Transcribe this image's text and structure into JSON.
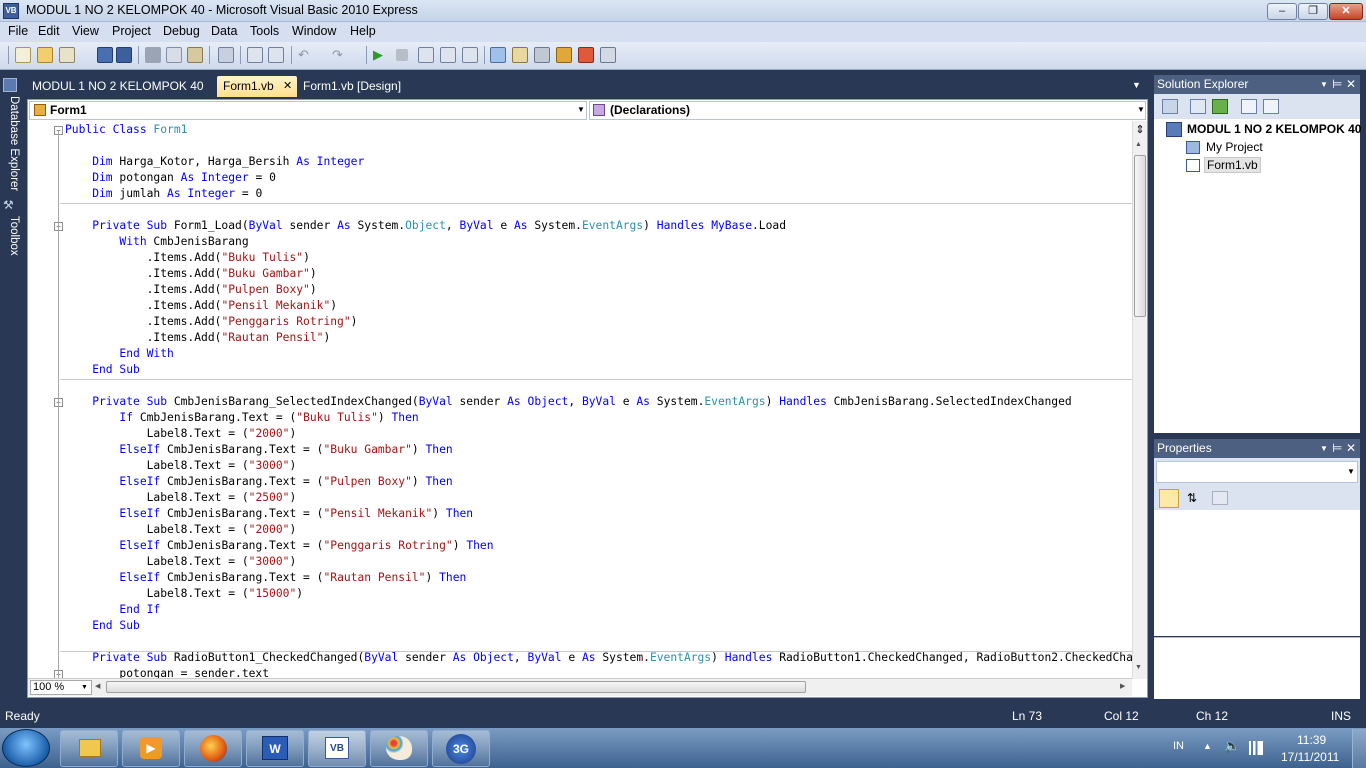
{
  "window": {
    "title": "MODUL 1 NO 2 KELOMPOK 40 - Microsoft Visual Basic 2010 Express",
    "app_icon": "VB"
  },
  "menu": [
    "File",
    "Edit",
    "View",
    "Project",
    "Debug",
    "Data",
    "Tools",
    "Window",
    "Help"
  ],
  "side_tabs": {
    "database_explorer": "Database Explorer",
    "toolbox": "Toolbox"
  },
  "doc_tabs": [
    "MODUL 1 NO 2 KELOMPOK 40",
    "Form1.vb",
    "Form1.vb [Design]"
  ],
  "editor": {
    "class_dropdown": "Form1",
    "method_dropdown": "(Declarations)",
    "zoom": "100 %"
  },
  "code": [
    [
      [
        "kw",
        "Public Class "
      ],
      [
        "ty",
        "Form1"
      ]
    ],
    [],
    [
      [
        "kw",
        "    Dim "
      ],
      [
        "n",
        "Harga_Kotor, Harga_Bersih "
      ],
      [
        "kw",
        "As Integer"
      ]
    ],
    [
      [
        "kw",
        "    Dim "
      ],
      [
        "n",
        "potongan "
      ],
      [
        "kw",
        "As Integer "
      ],
      [
        "n",
        "= 0"
      ]
    ],
    [
      [
        "kw",
        "    Dim "
      ],
      [
        "n",
        "jumlah "
      ],
      [
        "kw",
        "As Integer "
      ],
      [
        "n",
        "= 0"
      ]
    ],
    [],
    [
      [
        "kw",
        "    Private Sub "
      ],
      [
        "n",
        "Form1_Load("
      ],
      [
        "kw",
        "ByVal "
      ],
      [
        "n",
        "sender "
      ],
      [
        "kw",
        "As "
      ],
      [
        "n",
        "System."
      ],
      [
        "ty",
        "Object"
      ],
      [
        "n",
        ", "
      ],
      [
        "kw",
        "ByVal "
      ],
      [
        "n",
        "e "
      ],
      [
        "kw",
        "As "
      ],
      [
        "n",
        "System."
      ],
      [
        "ty",
        "EventArgs"
      ],
      [
        "n",
        ") "
      ],
      [
        "kw",
        "Handles MyBase"
      ],
      [
        "n",
        ".Load"
      ]
    ],
    [
      [
        "kw",
        "        With "
      ],
      [
        "n",
        "CmbJenisBarang"
      ]
    ],
    [
      [
        "n",
        "            .Items.Add("
      ],
      [
        "st",
        "\"Buku Tulis\""
      ],
      [
        "n",
        ")"
      ]
    ],
    [
      [
        "n",
        "            .Items.Add("
      ],
      [
        "st",
        "\"Buku Gambar\""
      ],
      [
        "n",
        ")"
      ]
    ],
    [
      [
        "n",
        "            .Items.Add("
      ],
      [
        "st",
        "\"Pulpen Boxy\""
      ],
      [
        "n",
        ")"
      ]
    ],
    [
      [
        "n",
        "            .Items.Add("
      ],
      [
        "st",
        "\"Pensil Mekanik\""
      ],
      [
        "n",
        ")"
      ]
    ],
    [
      [
        "n",
        "            .Items.Add("
      ],
      [
        "st",
        "\"Penggaris Rotring\""
      ],
      [
        "n",
        ")"
      ]
    ],
    [
      [
        "n",
        "            .Items.Add("
      ],
      [
        "st",
        "\"Rautan Pensil\""
      ],
      [
        "n",
        ")"
      ]
    ],
    [
      [
        "kw",
        "        End With"
      ]
    ],
    [
      [
        "kw",
        "    End Sub"
      ]
    ],
    [],
    [
      [
        "kw",
        "    Private Sub "
      ],
      [
        "n",
        "CmbJenisBarang_SelectedIndexChanged("
      ],
      [
        "kw",
        "ByVal "
      ],
      [
        "n",
        "sender "
      ],
      [
        "kw",
        "As Object"
      ],
      [
        "n",
        ", "
      ],
      [
        "kw",
        "ByVal "
      ],
      [
        "n",
        "e "
      ],
      [
        "kw",
        "As "
      ],
      [
        "n",
        "System."
      ],
      [
        "ty",
        "EventArgs"
      ],
      [
        "n",
        ") "
      ],
      [
        "kw",
        "Handles "
      ],
      [
        "n",
        "CmbJenisBarang.SelectedIndexChanged"
      ]
    ],
    [
      [
        "kw",
        "        If "
      ],
      [
        "n",
        "CmbJenisBarang.Text = ("
      ],
      [
        "st",
        "\"Buku Tulis\""
      ],
      [
        "n",
        ") "
      ],
      [
        "kw",
        "Then"
      ]
    ],
    [
      [
        "n",
        "            Label8.Text = ("
      ],
      [
        "st",
        "\"2000\""
      ],
      [
        "n",
        ")"
      ]
    ],
    [
      [
        "kw",
        "        ElseIf "
      ],
      [
        "n",
        "CmbJenisBarang.Text = ("
      ],
      [
        "st",
        "\"Buku Gambar\""
      ],
      [
        "n",
        ") "
      ],
      [
        "kw",
        "Then"
      ]
    ],
    [
      [
        "n",
        "            Label8.Text = ("
      ],
      [
        "st",
        "\"3000\""
      ],
      [
        "n",
        ")"
      ]
    ],
    [
      [
        "kw",
        "        ElseIf "
      ],
      [
        "n",
        "CmbJenisBarang.Text = ("
      ],
      [
        "st",
        "\"Pulpen Boxy\""
      ],
      [
        "n",
        ") "
      ],
      [
        "kw",
        "Then"
      ]
    ],
    [
      [
        "n",
        "            Label8.Text = ("
      ],
      [
        "st",
        "\"2500\""
      ],
      [
        "n",
        ")"
      ]
    ],
    [
      [
        "kw",
        "        ElseIf "
      ],
      [
        "n",
        "CmbJenisBarang.Text = ("
      ],
      [
        "st",
        "\"Pensil Mekanik\""
      ],
      [
        "n",
        ") "
      ],
      [
        "kw",
        "Then"
      ]
    ],
    [
      [
        "n",
        "            Label8.Text = ("
      ],
      [
        "st",
        "\"2000\""
      ],
      [
        "n",
        ")"
      ]
    ],
    [
      [
        "kw",
        "        ElseIf "
      ],
      [
        "n",
        "CmbJenisBarang.Text = ("
      ],
      [
        "st",
        "\"Penggaris Rotring\""
      ],
      [
        "n",
        ") "
      ],
      [
        "kw",
        "Then"
      ]
    ],
    [
      [
        "n",
        "            Label8.Text = ("
      ],
      [
        "st",
        "\"3000\""
      ],
      [
        "n",
        ")"
      ]
    ],
    [
      [
        "kw",
        "        ElseIf "
      ],
      [
        "n",
        "CmbJenisBarang.Text = ("
      ],
      [
        "st",
        "\"Rautan Pensil\""
      ],
      [
        "n",
        ") "
      ],
      [
        "kw",
        "Then"
      ]
    ],
    [
      [
        "n",
        "            Label8.Text = ("
      ],
      [
        "st",
        "\"15000\""
      ],
      [
        "n",
        ")"
      ]
    ],
    [
      [
        "kw",
        "        End If"
      ]
    ],
    [
      [
        "kw",
        "    End Sub"
      ]
    ],
    [],
    [
      [
        "kw",
        "    Private Sub "
      ],
      [
        "n",
        "RadioButton1_CheckedChanged("
      ],
      [
        "kw",
        "ByVal "
      ],
      [
        "n",
        "sender "
      ],
      [
        "kw",
        "As Object"
      ],
      [
        "n",
        ", "
      ],
      [
        "kw",
        "ByVal "
      ],
      [
        "n",
        "e "
      ],
      [
        "kw",
        "As "
      ],
      [
        "n",
        "System."
      ],
      [
        "ty",
        "EventArgs"
      ],
      [
        "n",
        ") "
      ],
      [
        "kw",
        "Handles "
      ],
      [
        "n",
        "RadioButton1.CheckedChanged, RadioButton2.CheckedChanged"
      ]
    ],
    [
      [
        "n",
        "        potongan = sender.text"
      ]
    ]
  ],
  "solution_explorer": {
    "title": "Solution Explorer",
    "project": "MODUL 1 NO 2 KELOMPOK 40",
    "items": [
      "My Project",
      "Form1.vb"
    ]
  },
  "properties": {
    "title": "Properties"
  },
  "status": {
    "ready": "Ready",
    "line": "Ln 73",
    "col": "Col 12",
    "ch": "Ch 12",
    "mode": "INS"
  },
  "tray": {
    "lang": "IN",
    "time": "11:39",
    "date": "17/11/2011"
  }
}
